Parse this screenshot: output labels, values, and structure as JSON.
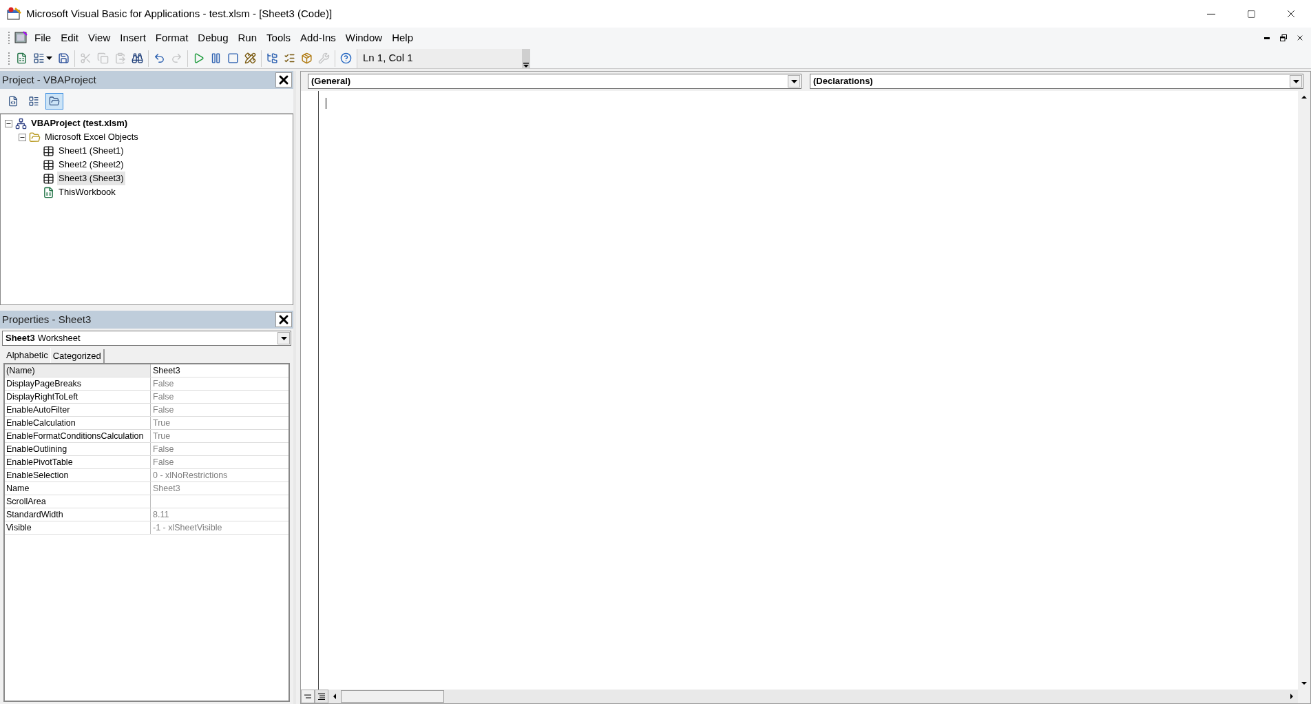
{
  "window": {
    "title": "Microsoft Visual Basic for Applications - test.xlsm - [Sheet3 (Code)]"
  },
  "menu": [
    "File",
    "Edit",
    "View",
    "Insert",
    "Format",
    "Debug",
    "Run",
    "Tools",
    "Add-Ins",
    "Window",
    "Help"
  ],
  "toolbar": {
    "groups": [
      [
        {
          "kind": "excel",
          "disabled": false
        },
        {
          "kind": "insert",
          "disabled": false
        },
        {
          "kind": "save",
          "disabled": false
        }
      ],
      [
        {
          "kind": "cut",
          "disabled": true
        },
        {
          "kind": "copy",
          "disabled": true
        },
        {
          "kind": "paste",
          "disabled": true
        },
        {
          "kind": "find",
          "disabled": false
        }
      ],
      [
        {
          "kind": "undo",
          "disabled": false
        },
        {
          "kind": "redo",
          "disabled": true
        }
      ],
      [
        {
          "kind": "run",
          "disabled": false
        },
        {
          "kind": "break",
          "disabled": false
        },
        {
          "kind": "reset",
          "disabled": false
        },
        {
          "kind": "design",
          "disabled": false
        }
      ],
      [
        {
          "kind": "explorer",
          "disabled": false
        },
        {
          "kind": "properties",
          "disabled": false
        },
        {
          "kind": "browser",
          "disabled": false
        },
        {
          "kind": "toolbox",
          "disabled": true
        }
      ],
      [
        {
          "kind": "help",
          "disabled": false
        }
      ]
    ],
    "position": "Ln 1, Col 1"
  },
  "project": {
    "title": "Project - VBAProject",
    "buttons": [
      {
        "kind": "code",
        "selected": false
      },
      {
        "kind": "object",
        "selected": false
      },
      {
        "kind": "folders",
        "selected": true
      }
    ],
    "tree": [
      {
        "label": "VBAProject (test.xlsm)",
        "kind": "project",
        "expanded": true,
        "selected": false,
        "children": [
          {
            "label": "Microsoft Excel Objects",
            "kind": "folder",
            "expanded": true,
            "selected": false,
            "children": [
              {
                "label": "Sheet1 (Sheet1)",
                "kind": "sheet",
                "selected": false
              },
              {
                "label": "Sheet2 (Sheet2)",
                "kind": "sheet",
                "selected": false
              },
              {
                "label": "Sheet3 (Sheet3)",
                "kind": "sheet",
                "selected": true
              },
              {
                "label": "ThisWorkbook",
                "kind": "workbook",
                "selected": false
              }
            ]
          }
        ]
      }
    ]
  },
  "properties": {
    "title": "Properties - Sheet3",
    "object_name": "Sheet3",
    "object_type": "Worksheet",
    "tabs": [
      {
        "label": "Alphabetic",
        "selected": true
      },
      {
        "label": "Categorized",
        "selected": false
      }
    ],
    "rows": [
      {
        "name": "(Name)",
        "value": "Sheet3",
        "selected": true
      },
      {
        "name": "DisplayPageBreaks",
        "value": "False",
        "selected": false
      },
      {
        "name": "DisplayRightToLeft",
        "value": "False",
        "selected": false
      },
      {
        "name": "EnableAutoFilter",
        "value": "False",
        "selected": false
      },
      {
        "name": "EnableCalculation",
        "value": "True",
        "selected": false
      },
      {
        "name": "EnableFormatConditionsCalculation",
        "value": "True",
        "selected": false
      },
      {
        "name": "EnableOutlining",
        "value": "False",
        "selected": false
      },
      {
        "name": "EnablePivotTable",
        "value": "False",
        "selected": false
      },
      {
        "name": "EnableSelection",
        "value": "0 - xlNoRestrictions",
        "selected": false
      },
      {
        "name": "Name",
        "value": "Sheet3",
        "selected": false
      },
      {
        "name": "ScrollArea",
        "selected": false
      },
      {
        "name": "StandardWidth",
        "value": "8.11",
        "selected": false
      },
      {
        "name": "Visible",
        "value": "-1 - xlSheetVisible",
        "selected": false
      }
    ]
  },
  "code": {
    "object": "(General)",
    "procedure": "(Declarations)"
  }
}
